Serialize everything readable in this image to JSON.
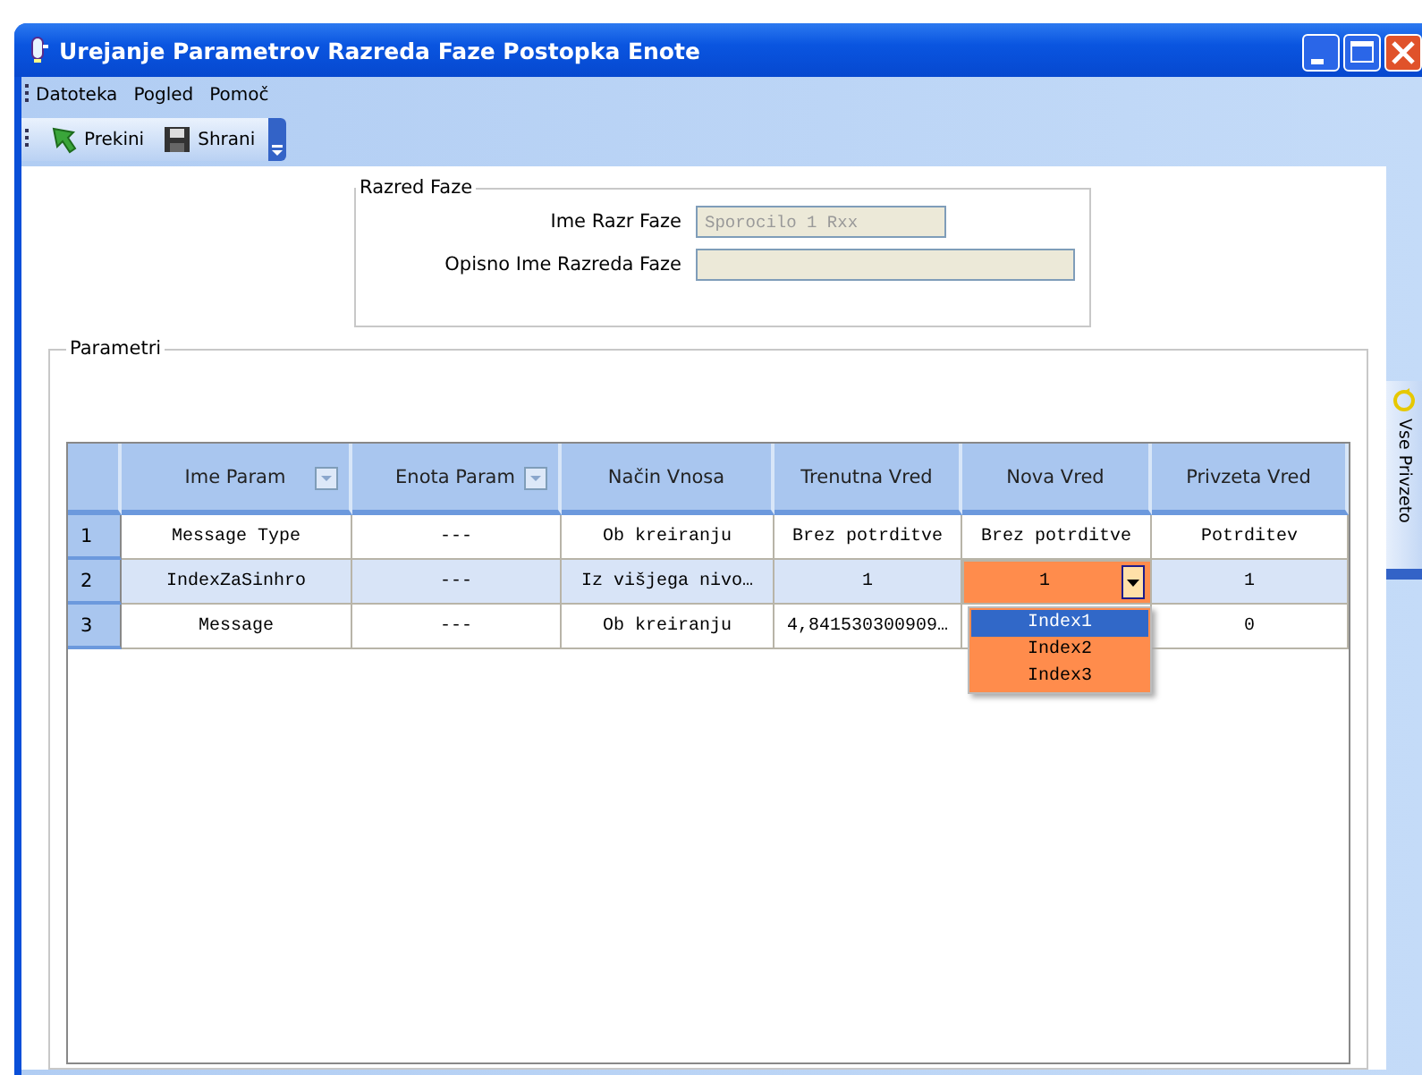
{
  "window": {
    "title": "Urejanje Parametrov Razreda Faze Postopka Enote"
  },
  "menu": [
    "Datoteka",
    "Pogled",
    "Pomoč"
  ],
  "toolbar": [
    {
      "kind": "cancel",
      "label": "Prekini"
    },
    {
      "kind": "save",
      "label": "Shrani"
    }
  ],
  "razred_faze": {
    "title": "Razred Faze",
    "fields": [
      {
        "label": "Ime Razr Faze",
        "value": "Sporocilo 1 Rxx"
      },
      {
        "label": "Opisno Ime Razreda Faze"
      }
    ]
  },
  "parametri": {
    "title": "Parametri",
    "columns": [
      {
        "label": "Ime Param",
        "filter": true
      },
      {
        "label": "Enota Param",
        "filter": true
      },
      {
        "label": "Način Vnosa",
        "filter": false
      },
      {
        "label": "Trenutna Vred",
        "filter": false
      },
      {
        "label": "Nova Vred",
        "filter": false
      },
      {
        "label": "Privzeta Vred",
        "filter": false
      }
    ],
    "rows": [
      {
        "number": "1",
        "selected": false,
        "cells": [
          "Message Type",
          "---",
          "Ob kreiranju",
          "Brez potrditve",
          "Brez potrditve",
          "Potrditev"
        ]
      },
      {
        "number": "2",
        "selected": true,
        "cells": [
          "IndexZaSinhro",
          "---",
          "Iz višjega nivo…",
          "1",
          {
            "kind": "combo",
            "text": "1"
          },
          "1"
        ]
      },
      {
        "number": "3",
        "selected": false,
        "cells": [
          "Message",
          "---",
          "Ob kreiranju",
          "4,841530300909…",
          null,
          "0"
        ]
      }
    ],
    "dropdown": [
      {
        "label": "Index1",
        "selected": true
      },
      {
        "label": "Index2",
        "selected": false
      },
      {
        "label": "Index3",
        "selected": false
      }
    ]
  },
  "side_panel": {
    "label": "Vse Privzeto"
  }
}
